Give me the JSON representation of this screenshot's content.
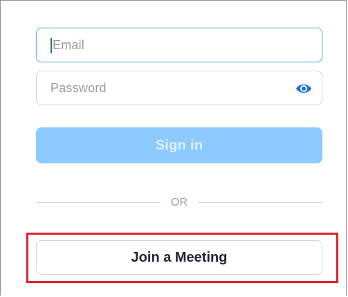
{
  "login": {
    "email_placeholder": "Email",
    "password_placeholder": "Password",
    "sign_in_label": "Sign in",
    "divider_text": "OR",
    "join_meeting_label": "Join a Meeting"
  },
  "icons": {
    "password_toggle": "eye-icon"
  },
  "colors": {
    "primary_disabled": "#8ccaff",
    "focus_border": "#6aaee8",
    "highlight": "#e0202b",
    "eye_icon": "#1a73e8"
  }
}
